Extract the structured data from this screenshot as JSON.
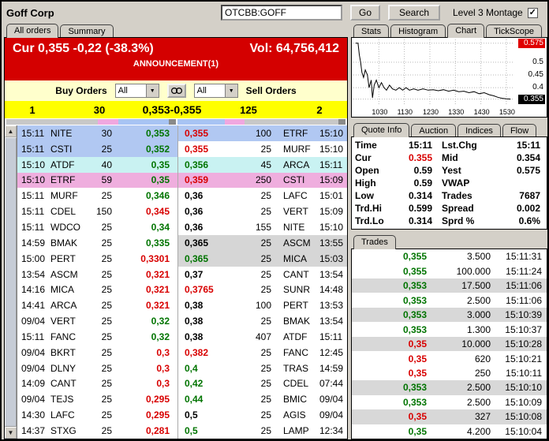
{
  "icons": {
    "check": "✓",
    "dropdown_arrow": "▼",
    "up_arrow": "▲",
    "down_arrow": "▼"
  },
  "header": {
    "company": "Goff Corp",
    "symbol_input": "OTCBB:GOFF",
    "go_label": "Go",
    "search_label": "Search",
    "montage_label": "Level 3 Montage"
  },
  "left": {
    "tabs": [
      "All orders",
      "Summary"
    ],
    "cur_line": "Cur 0,355 -0,22 (-38.3%)",
    "vol_line": "Vol: 64,756,412",
    "announcement": "ANNOUNCEMENT(1)",
    "buy_label": "Buy Orders",
    "sell_label": "Sell Orders",
    "buy_filter": "All",
    "sell_filter": "All",
    "summary": {
      "buy_count": "1",
      "buy_size": "30",
      "spread": "0,353-0,355",
      "sell_size": "125",
      "sell_count": "2"
    },
    "depth_bar": {
      "left": [
        {
          "color": "#c8c8c8",
          "pct": 54
        },
        {
          "color": "#f0a8e0",
          "pct": 12
        },
        {
          "color": "#a8c4f4",
          "pct": 30
        },
        {
          "color": "#8a8a8a",
          "pct": 4
        }
      ],
      "right": [
        {
          "color": "#a8c4f4",
          "pct": 28
        },
        {
          "color": "#f0a8e0",
          "pct": 12
        },
        {
          "color": "#c8c8c8",
          "pct": 56
        },
        {
          "color": "#8a8a8a",
          "pct": 4
        }
      ]
    },
    "book": [
      {
        "btime": "15:11",
        "bmpid": "NITE",
        "bsize": "30",
        "bid": "0,353",
        "bc": "green",
        "bbg": "blue",
        "ask": "0,355",
        "ac": "red",
        "asize": "100",
        "ampid": "ETRF",
        "atime": "15:10",
        "abg": "blue"
      },
      {
        "btime": "15:11",
        "bmpid": "CSTI",
        "bsize": "25",
        "bid": "0,352",
        "bc": "green",
        "bbg": "blue",
        "ask": "0,355",
        "ac": "red",
        "asize": "25",
        "ampid": "MURF",
        "atime": "15:10",
        "abg": "white"
      },
      {
        "btime": "15:10",
        "bmpid": "ATDF",
        "bsize": "40",
        "bid": "0,35",
        "bc": "green",
        "bbg": "cyan",
        "ask": "0,356",
        "ac": "green",
        "asize": "45",
        "ampid": "ARCA",
        "atime": "15:11",
        "abg": "cyan"
      },
      {
        "btime": "15:10",
        "bmpid": "ETRF",
        "bsize": "59",
        "bid": "0,35",
        "bc": "green",
        "bbg": "pink",
        "ask": "0,359",
        "ac": "red",
        "asize": "250",
        "ampid": "CSTI",
        "atime": "15:09",
        "abg": "pink"
      },
      {
        "btime": "15:11",
        "bmpid": "MURF",
        "bsize": "25",
        "bid": "0,346",
        "bc": "green",
        "bbg": "white",
        "ask": "0,36",
        "ac": "black",
        "asize": "25",
        "ampid": "LAFC",
        "atime": "15:01",
        "abg": "white"
      },
      {
        "btime": "15:11",
        "bmpid": "CDEL",
        "bsize": "150",
        "bid": "0,345",
        "bc": "red",
        "bbg": "white",
        "ask": "0,36",
        "ac": "black",
        "asize": "25",
        "ampid": "VERT",
        "atime": "15:09",
        "abg": "white"
      },
      {
        "btime": "15:11",
        "bmpid": "WDCO",
        "bsize": "25",
        "bid": "0,34",
        "bc": "green",
        "bbg": "white",
        "ask": "0,36",
        "ac": "black",
        "asize": "155",
        "ampid": "NITE",
        "atime": "15:10",
        "abg": "white"
      },
      {
        "btime": "14:59",
        "bmpid": "BMAK",
        "bsize": "25",
        "bid": "0,335",
        "bc": "green",
        "bbg": "white",
        "ask": "0,365",
        "ac": "black",
        "asize": "25",
        "ampid": "ASCM",
        "atime": "13:55",
        "abg": "gray"
      },
      {
        "btime": "15:00",
        "bmpid": "PERT",
        "bsize": "25",
        "bid": "0,3301",
        "bc": "red",
        "bbg": "white",
        "ask": "0,365",
        "ac": "green",
        "asize": "25",
        "ampid": "MICA",
        "atime": "15:03",
        "abg": "gray"
      },
      {
        "btime": "13:54",
        "bmpid": "ASCM",
        "bsize": "25",
        "bid": "0,321",
        "bc": "red",
        "bbg": "white",
        "ask": "0,37",
        "ac": "black",
        "asize": "25",
        "ampid": "CANT",
        "atime": "13:54",
        "abg": "white"
      },
      {
        "btime": "14:16",
        "bmpid": "MICA",
        "bsize": "25",
        "bid": "0,321",
        "bc": "red",
        "bbg": "white",
        "ask": "0,3765",
        "ac": "red",
        "asize": "25",
        "ampid": "SUNR",
        "atime": "14:48",
        "abg": "white"
      },
      {
        "btime": "14:41",
        "bmpid": "ARCA",
        "bsize": "25",
        "bid": "0,321",
        "bc": "red",
        "bbg": "white",
        "ask": "0,38",
        "ac": "black",
        "asize": "100",
        "ampid": "PERT",
        "atime": "13:53",
        "abg": "white"
      },
      {
        "btime": "09/04",
        "bmpid": "VERT",
        "bsize": "25",
        "bid": "0,32",
        "bc": "green",
        "bbg": "white",
        "ask": "0,38",
        "ac": "black",
        "asize": "25",
        "ampid": "BMAK",
        "atime": "13:54",
        "abg": "white"
      },
      {
        "btime": "15:11",
        "bmpid": "FANC",
        "bsize": "25",
        "bid": "0,32",
        "bc": "green",
        "bbg": "white",
        "ask": "0,38",
        "ac": "black",
        "asize": "407",
        "ampid": "ATDF",
        "atime": "15:11",
        "abg": "white"
      },
      {
        "btime": "09/04",
        "bmpid": "BKRT",
        "bsize": "25",
        "bid": "0,3",
        "bc": "red",
        "bbg": "white",
        "ask": "0,382",
        "ac": "red",
        "asize": "25",
        "ampid": "FANC",
        "atime": "12:45",
        "abg": "white"
      },
      {
        "btime": "09/04",
        "bmpid": "DLNY",
        "bsize": "25",
        "bid": "0,3",
        "bc": "red",
        "bbg": "white",
        "ask": "0,4",
        "ac": "green",
        "asize": "25",
        "ampid": "TRAS",
        "atime": "14:59",
        "abg": "white"
      },
      {
        "btime": "14:09",
        "bmpid": "CANT",
        "bsize": "25",
        "bid": "0,3",
        "bc": "red",
        "bbg": "white",
        "ask": "0,42",
        "ac": "green",
        "asize": "25",
        "ampid": "CDEL",
        "atime": "07:44",
        "abg": "white"
      },
      {
        "btime": "09/04",
        "bmpid": "TEJS",
        "bsize": "25",
        "bid": "0,295",
        "bc": "red",
        "bbg": "white",
        "ask": "0,44",
        "ac": "green",
        "asize": "25",
        "ampid": "BMIC",
        "atime": "09/04",
        "abg": "white"
      },
      {
        "btime": "14:30",
        "bmpid": "LAFC",
        "bsize": "25",
        "bid": "0,295",
        "bc": "red",
        "bbg": "white",
        "ask": "0,5",
        "ac": "black",
        "asize": "25",
        "ampid": "AGIS",
        "atime": "09/04",
        "abg": "white"
      },
      {
        "btime": "14:37",
        "bmpid": "STXG",
        "bsize": "25",
        "bid": "0,281",
        "bc": "red",
        "bbg": "white",
        "ask": "0,5",
        "ac": "green",
        "asize": "25",
        "ampid": "LAMP",
        "atime": "12:34",
        "abg": "white"
      }
    ]
  },
  "right": {
    "chart_tabs": [
      "Stats",
      "Histogram",
      "Chart",
      "TickScope"
    ],
    "info_tabs": [
      "Quote Info",
      "Auction",
      "Indices",
      "Flow"
    ],
    "trades_tab": "Trades",
    "quote_rows": [
      {
        "l1": "Time",
        "v1": "15:11",
        "l2": "Lst.Chg",
        "v2": "15:11"
      },
      {
        "l1": "Cur",
        "v1": "0.355",
        "v1c": "red",
        "l2": "Mid",
        "v2": "0.354"
      },
      {
        "l1": "Open",
        "v1": "0.59",
        "l2": "Yest",
        "v2": "0.575"
      },
      {
        "l1": "High",
        "v1": "0.59",
        "l2": "VWAP",
        "v2": ""
      },
      {
        "l1": "Low",
        "v1": "0.314",
        "l2": "Trades",
        "v2": "7687"
      },
      {
        "l1": "Trd.Hi",
        "v1": "0.599",
        "l2": "Spread",
        "v2": "0.002"
      },
      {
        "l1": "Trd.Lo",
        "v1": "0.314",
        "l2": "Sprd %",
        "v2": "0.6%"
      }
    ],
    "trades": [
      {
        "price": "0,355",
        "size": "3.500",
        "time": "15:11:31",
        "color": "green",
        "bg": "w"
      },
      {
        "price": "0,355",
        "size": "100.000",
        "time": "15:11:24",
        "color": "green",
        "bg": "w"
      },
      {
        "price": "0,353",
        "size": "17.500",
        "time": "15:11:06",
        "color": "green",
        "bg": "g"
      },
      {
        "price": "0,353",
        "size": "2.500",
        "time": "15:11:06",
        "color": "green",
        "bg": "w"
      },
      {
        "price": "0,353",
        "size": "3.000",
        "time": "15:10:39",
        "color": "green",
        "bg": "g"
      },
      {
        "price": "0,353",
        "size": "1.300",
        "time": "15:10:37",
        "color": "green",
        "bg": "w"
      },
      {
        "price": "0,35",
        "size": "10.000",
        "time": "15:10:28",
        "color": "red",
        "bg": "g"
      },
      {
        "price": "0,35",
        "size": "620",
        "time": "15:10:21",
        "color": "red",
        "bg": "w"
      },
      {
        "price": "0,35",
        "size": "250",
        "time": "15:10:11",
        "color": "red",
        "bg": "w"
      },
      {
        "price": "0,353",
        "size": "2.500",
        "time": "15:10:10",
        "color": "green",
        "bg": "g"
      },
      {
        "price": "0,353",
        "size": "2.500",
        "time": "15:10:09",
        "color": "green",
        "bg": "w"
      },
      {
        "price": "0,35",
        "size": "327",
        "time": "15:10:08",
        "color": "red",
        "bg": "g"
      },
      {
        "price": "0,35",
        "size": "4.200",
        "time": "15:10:04",
        "color": "green",
        "bg": "w"
      }
    ]
  },
  "chart_data": {
    "type": "line",
    "title": "Intraday price chart",
    "x_range": [
      570,
      945
    ],
    "y_range": [
      0.335,
      0.59
    ],
    "x_ticks": [
      {
        "label": "1030",
        "min": 630
      },
      {
        "label": "1130",
        "min": 690
      },
      {
        "label": "1230",
        "min": 750
      },
      {
        "label": "1330",
        "min": 810
      },
      {
        "label": "1430",
        "min": 870
      },
      {
        "label": "1530",
        "min": 930
      }
    ],
    "y_labels": [
      {
        "label": "0.575",
        "price": 0.575,
        "style": "red"
      },
      {
        "label": "0.5",
        "price": 0.5,
        "style": "plain"
      },
      {
        "label": "0.45",
        "price": 0.45,
        "style": "plain"
      },
      {
        "label": "0.4",
        "price": 0.4,
        "style": "plain"
      },
      {
        "label": "0.355",
        "price": 0.355,
        "style": "black"
      }
    ],
    "points": [
      [
        575,
        0.575
      ],
      [
        581,
        0.575
      ],
      [
        584,
        0.53
      ],
      [
        587,
        0.5
      ],
      [
        590,
        0.46
      ],
      [
        594,
        0.44
      ],
      [
        598,
        0.47
      ],
      [
        603,
        0.45
      ],
      [
        607,
        0.4
      ],
      [
        612,
        0.43
      ],
      [
        615,
        0.36
      ],
      [
        619,
        0.41
      ],
      [
        624,
        0.43
      ],
      [
        630,
        0.4
      ],
      [
        636,
        0.42
      ],
      [
        642,
        0.4
      ],
      [
        648,
        0.39
      ],
      [
        655,
        0.41
      ],
      [
        662,
        0.395
      ],
      [
        670,
        0.39
      ],
      [
        678,
        0.4
      ],
      [
        686,
        0.39
      ],
      [
        694,
        0.4
      ],
      [
        702,
        0.39
      ],
      [
        712,
        0.395
      ],
      [
        722,
        0.39
      ],
      [
        734,
        0.395
      ],
      [
        746,
        0.39
      ],
      [
        758,
        0.392
      ],
      [
        770,
        0.388
      ],
      [
        782,
        0.392
      ],
      [
        794,
        0.386
      ],
      [
        806,
        0.39
      ],
      [
        818,
        0.384
      ],
      [
        830,
        0.386
      ],
      [
        842,
        0.38
      ],
      [
        854,
        0.384
      ],
      [
        866,
        0.376
      ],
      [
        878,
        0.38
      ],
      [
        890,
        0.372
      ],
      [
        900,
        0.368
      ],
      [
        910,
        0.362
      ],
      [
        920,
        0.358
      ],
      [
        930,
        0.356
      ],
      [
        940,
        0.355
      ]
    ]
  }
}
